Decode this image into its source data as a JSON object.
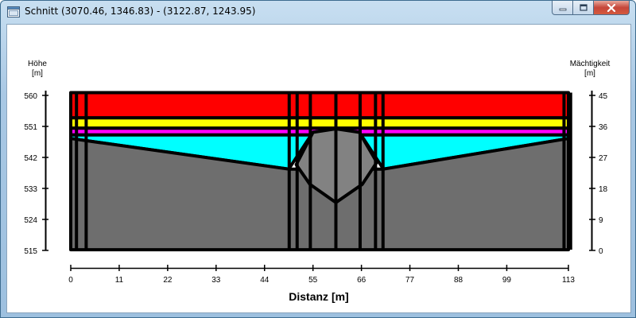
{
  "window": {
    "title": "Schnitt (3070.46, 1346.83) - (3122.87, 1243.95)",
    "controls": {
      "minimize": "minimize",
      "maximize": "maximize",
      "close": "close"
    }
  },
  "chart": {
    "left_axis": {
      "label_line1": "Höhe",
      "label_line2": "[m]",
      "ticks": [
        "560",
        "551",
        "542",
        "533",
        "524",
        "515"
      ]
    },
    "right_axis": {
      "label_line1": "Mächtigkeit",
      "label_line2": "[m]",
      "ticks": [
        "45",
        "36",
        "27",
        "18",
        "9",
        "0"
      ]
    },
    "x_axis": {
      "label": "Distanz [m]",
      "ticks": [
        "0",
        "11",
        "22",
        "33",
        "44",
        "55",
        "66",
        "77",
        "88",
        "99",
        "113"
      ]
    }
  },
  "chart_data": {
    "type": "area",
    "xlabel": "Distanz [m]",
    "ylabel": "Höhe [m]",
    "y2label": "Mächtigkeit [m]",
    "xlim": [
      0,
      113
    ],
    "ylim": [
      515,
      560
    ],
    "y2lim": [
      0,
      45
    ],
    "x_ticks": [
      0,
      11,
      22,
      33,
      44,
      55,
      66,
      77,
      88,
      99,
      113
    ],
    "y_ticks": [
      515,
      524,
      533,
      542,
      551,
      560
    ],
    "y2_ticks": [
      0,
      9,
      18,
      27,
      36,
      45
    ],
    "colors": {
      "red": "#ff0000",
      "yellow": "#ffff00",
      "magenta": "#ff00ff",
      "cyan": "#00ffff",
      "dark_gray": "#6e6e6e",
      "light_gray": "#828282",
      "outline": "#000000"
    },
    "layers": [
      {
        "color": "red",
        "top": [
          [
            0,
            560.8
          ],
          [
            113,
            560.8
          ]
        ],
        "bottom": [
          [
            0,
            553.5
          ],
          [
            113,
            553.5
          ]
        ]
      },
      {
        "color": "yellow",
        "top": [
          [
            0,
            553.5
          ],
          [
            113,
            553.5
          ]
        ],
        "bottom": [
          [
            0,
            550.5
          ],
          [
            113,
            550.5
          ]
        ]
      },
      {
        "color": "magenta",
        "top": [
          [
            0,
            550.5
          ],
          [
            113,
            550.5
          ]
        ],
        "bottom": [
          [
            0,
            548.5
          ],
          [
            113,
            548.5
          ]
        ]
      },
      {
        "color": "cyan",
        "top": [
          [
            0,
            548.5
          ],
          [
            113,
            548.5
          ]
        ],
        "bottom": [
          [
            0,
            547.5
          ],
          [
            49.5,
            538.6
          ],
          [
            55,
            549.3
          ],
          [
            60.2,
            550.3
          ],
          [
            65.5,
            549.3
          ],
          [
            71,
            538.6
          ],
          [
            113,
            547.5
          ]
        ]
      },
      {
        "color": "dark_gray",
        "top": [
          [
            0,
            547.5
          ],
          [
            49.5,
            538.6
          ],
          [
            71,
            538.6
          ],
          [
            113,
            547.5
          ]
        ],
        "bottom": [
          [
            0,
            515.2
          ],
          [
            113,
            515.2
          ]
        ]
      }
    ],
    "lens": {
      "color": "light_gray",
      "outline": [
        [
          55,
          549.3
        ],
        [
          60.2,
          550.3
        ],
        [
          65.5,
          549.3
        ],
        [
          69.5,
          540.6
        ],
        [
          66.2,
          534.2
        ],
        [
          60.2,
          528.9
        ],
        [
          54.3,
          534.2
        ],
        [
          51.2,
          539.9
        ]
      ]
    },
    "vertical_lines": [
      1.3,
      3.5,
      49.6,
      51.4,
      54.4,
      60.2,
      65.7,
      69.2,
      70.9,
      112.0,
      113.5
    ]
  }
}
